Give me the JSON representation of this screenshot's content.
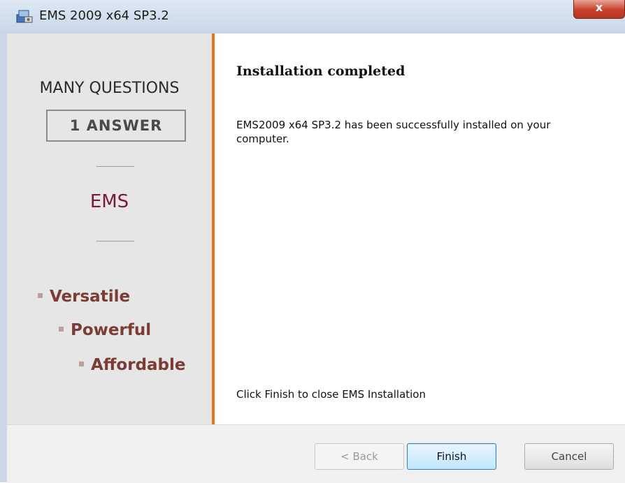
{
  "window": {
    "title": "EMS 2009 x64 SP3.2",
    "close_glyph": "x"
  },
  "banner": {
    "heading": "MANY QUESTIONS",
    "answer": "1 ANSWER",
    "brand": "EMS",
    "features": [
      "Versatile",
      "Powerful",
      "Affordable"
    ]
  },
  "content": {
    "title": "Installation completed",
    "body": "EMS2009 x64 SP3.2 has been successfully installed on your computer.",
    "footer": "Click Finish to close EMS Installation"
  },
  "buttons": {
    "back": "< Back",
    "finish": "Finish",
    "cancel": "Cancel"
  },
  "colors": {
    "accent_orange": "#e8711c",
    "brand": "#7a1a36",
    "feature_text": "#7a3c34"
  },
  "icons": {
    "app": "installer-icon",
    "close": "close-icon"
  }
}
